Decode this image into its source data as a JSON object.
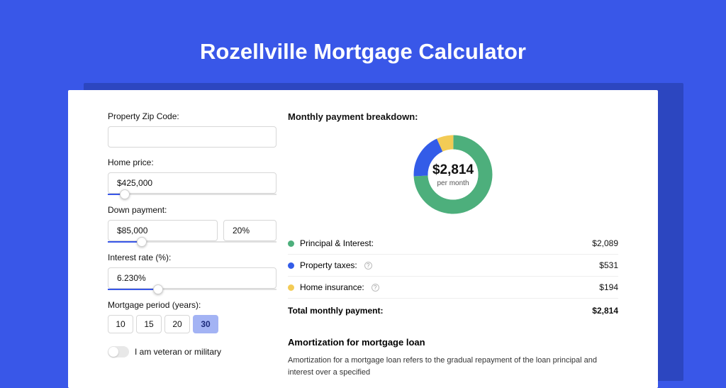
{
  "header": {
    "title": "Rozellville Mortgage Calculator"
  },
  "form": {
    "zip": {
      "label": "Property Zip Code:",
      "value": ""
    },
    "home_price": {
      "label": "Home price:",
      "value": "$425,000",
      "slider_fill_pct": 10,
      "thumb_pct": 10
    },
    "down_payment": {
      "label": "Down payment:",
      "amount": "$85,000",
      "pct": "20%",
      "slider_fill_pct": 20,
      "thumb_pct": 20
    },
    "interest": {
      "label": "Interest rate (%):",
      "value": "6.230%",
      "slider_fill_pct": 30,
      "thumb_pct": 30
    },
    "period": {
      "label": "Mortgage period (years):",
      "options": [
        "10",
        "15",
        "20",
        "30"
      ],
      "active_index": 3
    },
    "veteran": {
      "label": "I am veteran or military",
      "on": false
    }
  },
  "breakdown": {
    "title": "Monthly payment breakdown:",
    "center_amount": "$2,814",
    "center_sub": "per month",
    "items": [
      {
        "label": "Principal & Interest:",
        "value": "$2,089",
        "color": "green",
        "info": false
      },
      {
        "label": "Property taxes:",
        "value": "$531",
        "color": "blue",
        "info": true
      },
      {
        "label": "Home insurance:",
        "value": "$194",
        "color": "yellow",
        "info": true
      }
    ],
    "total_label": "Total monthly payment:",
    "total_value": "$2,814"
  },
  "amort": {
    "title": "Amortization for mortgage loan",
    "text": "Amortization for a mortgage loan refers to the gradual repayment of the loan principal and interest over a specified"
  },
  "chart_data": {
    "type": "pie",
    "title": "Monthly payment breakdown",
    "series": [
      {
        "name": "Principal & Interest",
        "value": 2089,
        "color": "#4DAF7C"
      },
      {
        "name": "Property taxes",
        "value": 531,
        "color": "#335CE8"
      },
      {
        "name": "Home insurance",
        "value": 194,
        "color": "#F3CB55"
      }
    ],
    "total": 2814,
    "unit": "USD/month"
  }
}
